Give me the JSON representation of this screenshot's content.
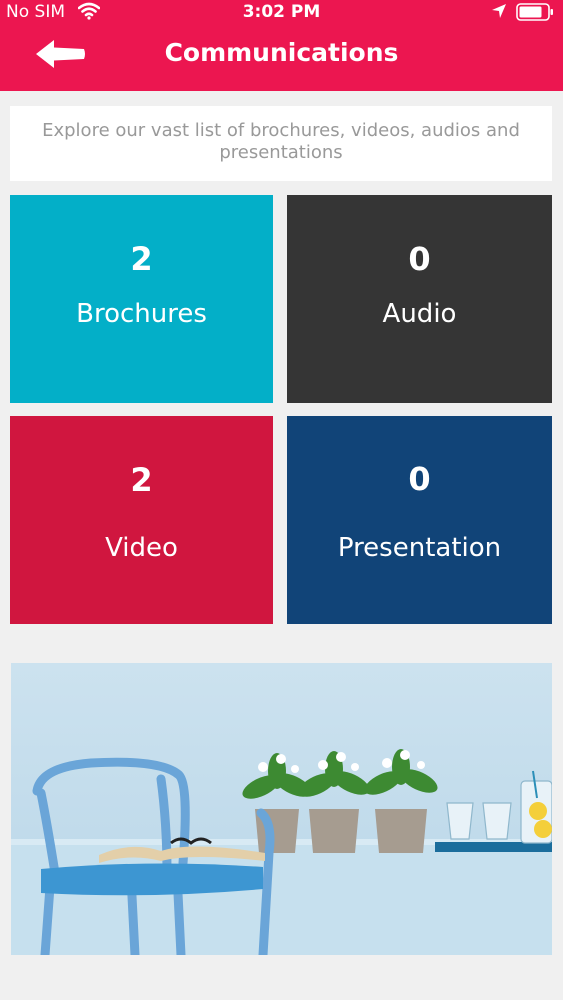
{
  "status_bar": {
    "carrier": "No SIM",
    "time": "3:02 PM"
  },
  "header": {
    "title": "Communications",
    "color": "#ec1650"
  },
  "intro": {
    "text": "Explore our vast list of brochures, videos, audios and presentations"
  },
  "tiles": [
    {
      "count": "2",
      "label": "Brochures",
      "color": "#03afc8"
    },
    {
      "count": "0",
      "label": "Audio",
      "color": "#353535"
    },
    {
      "count": "2",
      "label": "Video",
      "color": "#d0163f"
    },
    {
      "count": "0",
      "label": "Presentation",
      "color": "#114478"
    }
  ],
  "icons": [
    "wifi-icon",
    "location-arrow-icon",
    "battery-icon",
    "back-arrow-icon"
  ]
}
